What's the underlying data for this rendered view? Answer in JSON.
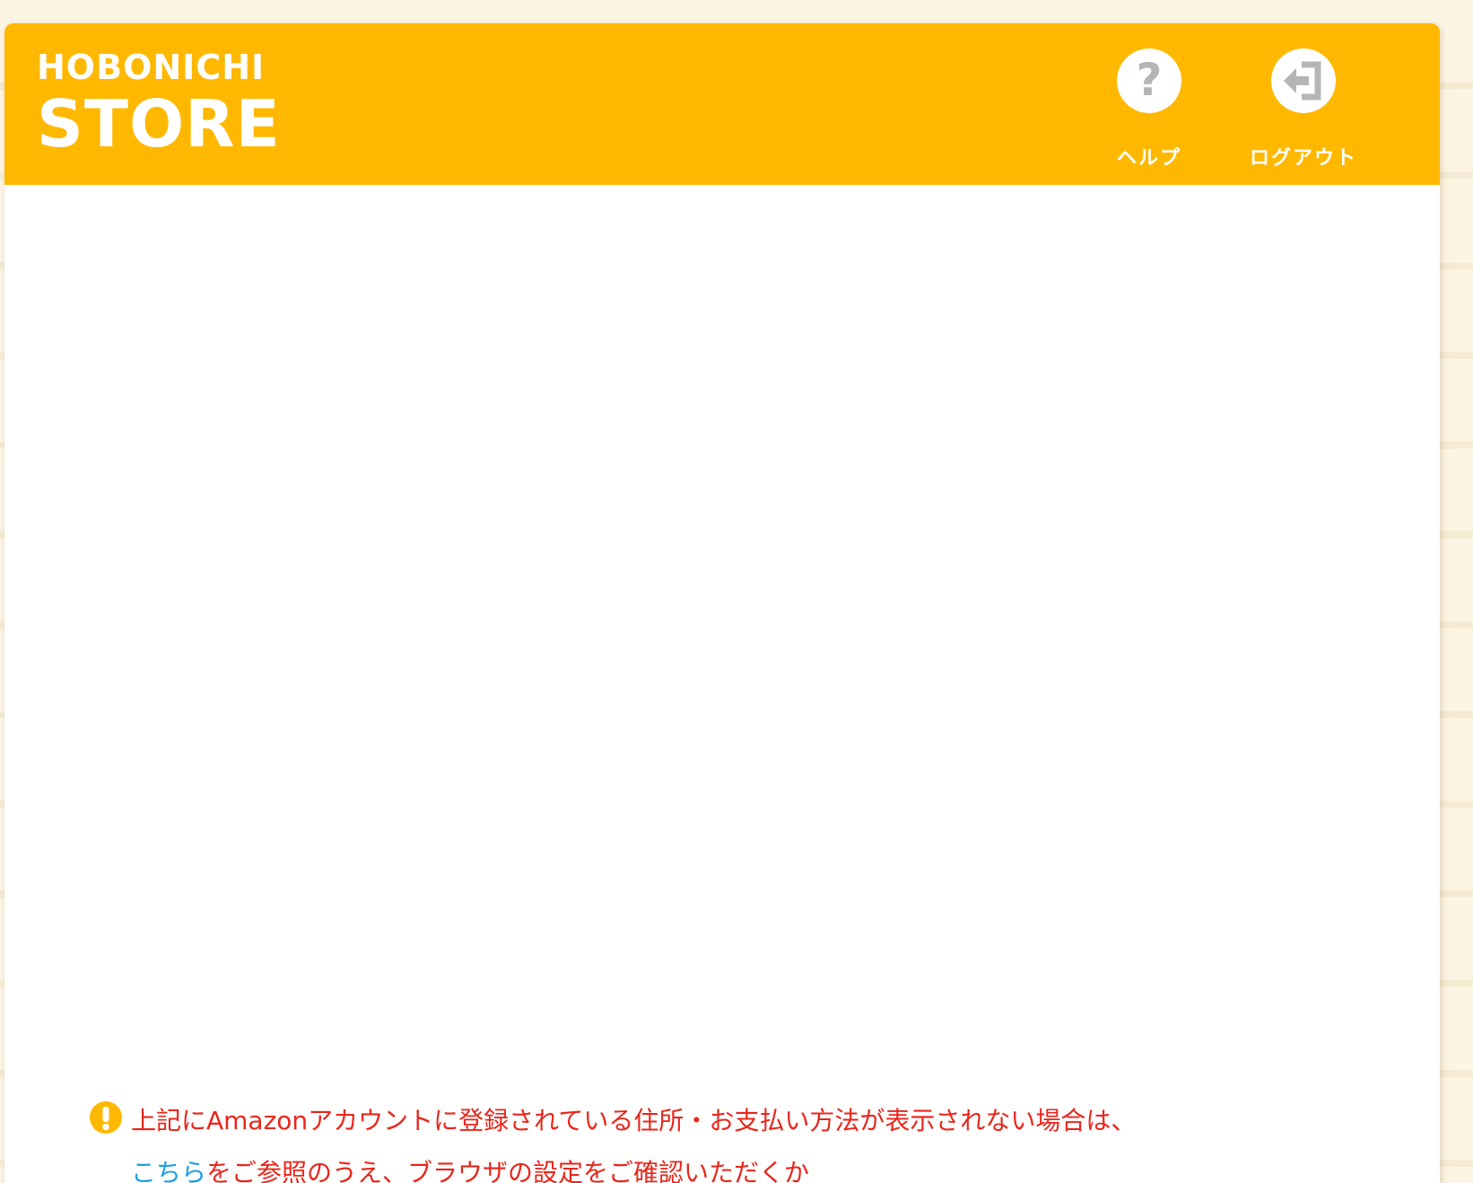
{
  "header": {
    "logo_top": "HOBONICHI",
    "logo_bottom": "STORE",
    "help": {
      "label": "ヘルプ",
      "icon": "help-icon"
    },
    "logout": {
      "label": "ログアウト",
      "icon": "logout-icon"
    }
  },
  "notice": {
    "icon": "exclamation-icon",
    "line1": "上記にAmazonアカウントに登録されている住所・お支払い方法が表示されない場合は、",
    "link_text": "こちら",
    "line2_rest": "をご参照のうえ、ブラウザの設定をご確認いただくか"
  },
  "colors": {
    "header_bg": "#ffb800",
    "notice_text": "#e8261b",
    "link": "#1aa0e0",
    "icon_gray": "#b5b5b5"
  }
}
